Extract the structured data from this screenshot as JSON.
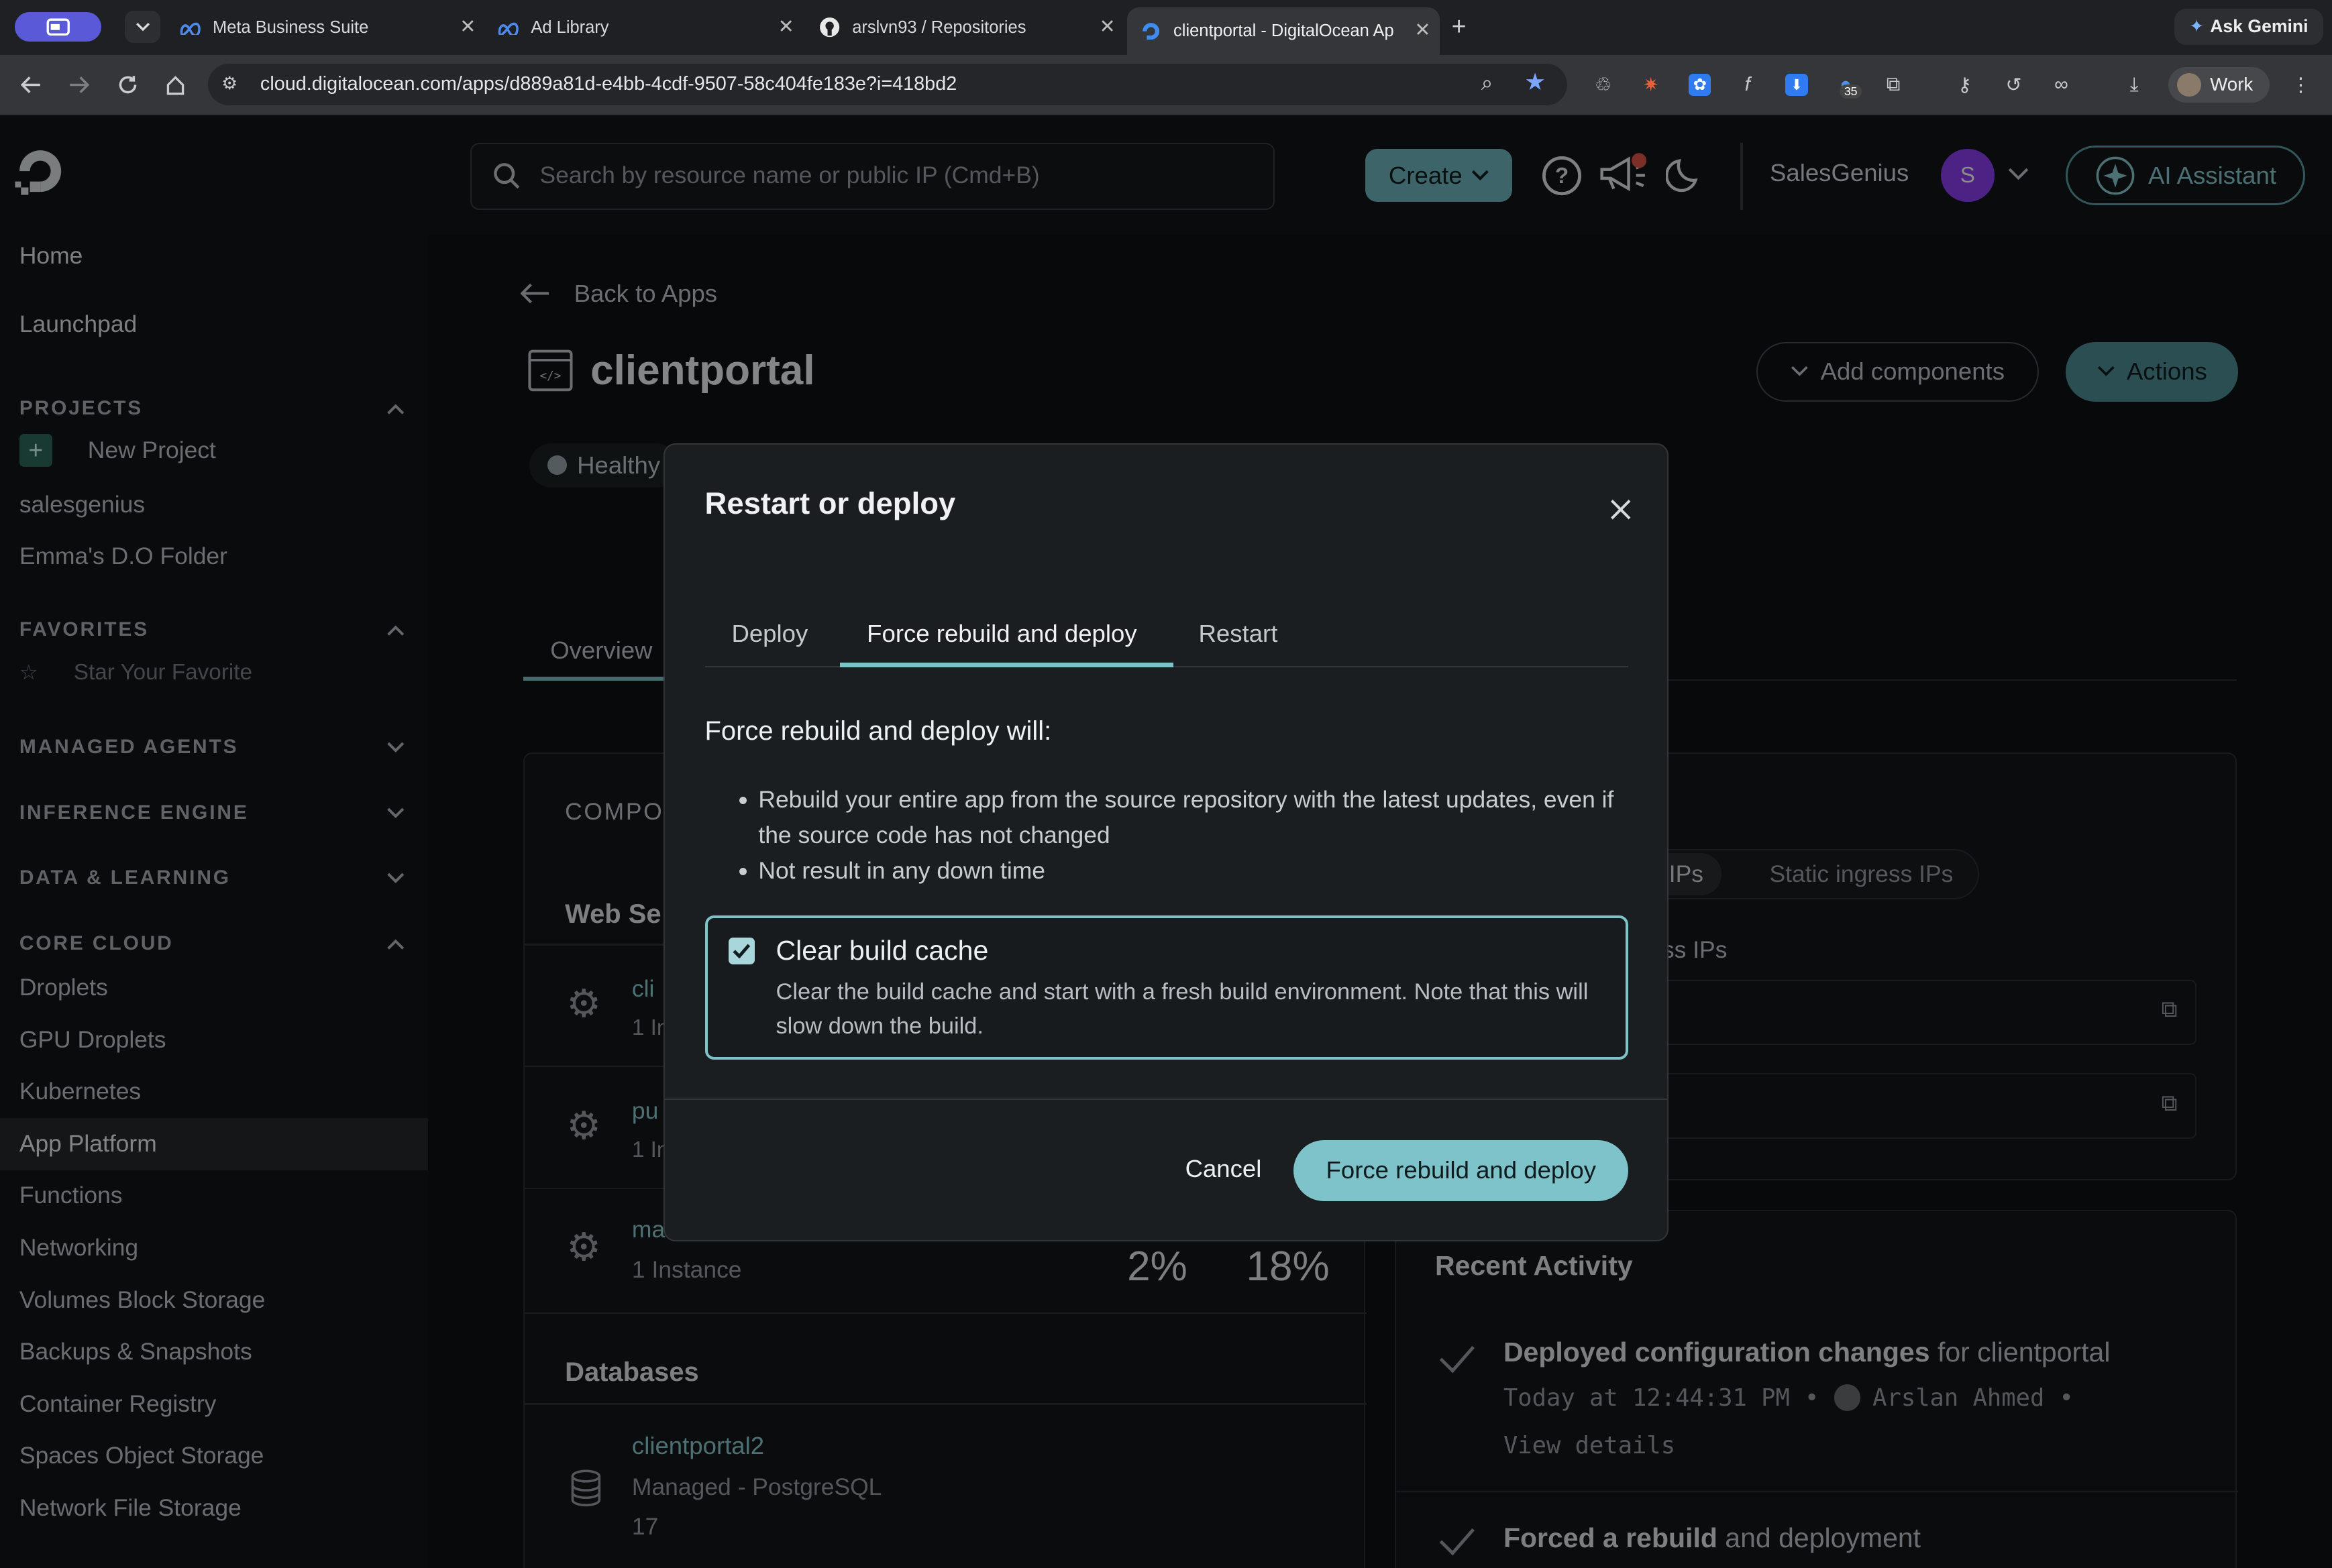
{
  "browser": {
    "tabs": [
      {
        "title": "Meta Business Suite"
      },
      {
        "title": "Ad Library"
      },
      {
        "title": "arslvn93 / Repositories"
      },
      {
        "title": "clientportal - DigitalOcean Ap"
      }
    ],
    "ask_gemini": "Ask Gemini",
    "url": "cloud.digitalocean.com/apps/d889a81d-e4bb-4cdf-9507-58c404fe183e?i=418bd2",
    "profile_label": "Work",
    "extension_badge": "35"
  },
  "topbar": {
    "search_placeholder": "Search by resource name or public IP (Cmd+B)",
    "create_label": "Create",
    "team_name": "SalesGenius",
    "avatar_initial": "S",
    "ai_assistant_label": "AI Assistant"
  },
  "sidebar": {
    "home": "Home",
    "launchpad": "Launchpad",
    "projects_heading": "PROJECTS",
    "new_project": "New Project",
    "projects": [
      "salesgenius",
      "Emma's D.O Folder"
    ],
    "favorites_heading": "FAVORITES",
    "star_favorite": "Star Your Favorite",
    "managed_agents": "MANAGED AGENTS",
    "inference_engine": "INFERENCE ENGINE",
    "data_learning": "DATA & LEARNING",
    "core_cloud": "CORE CLOUD",
    "core_items": [
      "Droplets",
      "GPU Droplets",
      "Kubernetes",
      "App Platform",
      "Functions",
      "Networking",
      "Volumes Block Storage",
      "Backups & Snapshots",
      "Container Registry",
      "Spaces Object Storage",
      "Network File Storage"
    ]
  },
  "page": {
    "back_link": "Back to Apps",
    "app_name": "clientportal",
    "add_components": "Add components",
    "actions": "Actions",
    "status": "Healthy",
    "overview_tab": "Overview",
    "components_heading": "COMPO",
    "web_services_heading": "Web Se",
    "services": [
      {
        "name": "cli",
        "meta": "1 In"
      },
      {
        "name": "pu",
        "meta": "1 In"
      },
      {
        "name": "ma",
        "meta": "1 Instance",
        "cpu": "2%",
        "mem": "18%"
      }
    ],
    "databases_heading": "Databases",
    "database": {
      "name": "clientportal2",
      "type": "Managed - PostgreSQL",
      "version": "17"
    },
    "ingress_tab_active": "ss IPs",
    "ingress_tab_static": "Static ingress IPs",
    "ingress_label": "ess IPs",
    "recent_activity_heading": "Recent Activity",
    "activities": [
      {
        "bold": "Deployed configuration changes",
        "rest": " for clientportal",
        "time": "Today at 12:44:31 PM",
        "user": "Arslan Ahmed",
        "link": "View details"
      },
      {
        "bold": "Forced a rebuild",
        "rest": " and deployment"
      }
    ]
  },
  "modal": {
    "title": "Restart or deploy",
    "tabs": [
      "Deploy",
      "Force rebuild and deploy",
      "Restart"
    ],
    "active_tab": "Force rebuild and deploy",
    "heading": "Force rebuild and deploy will:",
    "bullets": [
      "Rebuild your entire app from the source repository with the latest updates, even if the source code has not changed",
      "Not result in any down time"
    ],
    "checkbox_label": "Clear build cache",
    "checkbox_checked": true,
    "checkbox_desc": "Clear the build cache and start with a fresh build environment. Note that this will slow down the build.",
    "cancel": "Cancel",
    "submit": "Force rebuild and deploy"
  },
  "colors": {
    "accent": "#7ec3c9",
    "avatar": "#8b3ff2"
  }
}
